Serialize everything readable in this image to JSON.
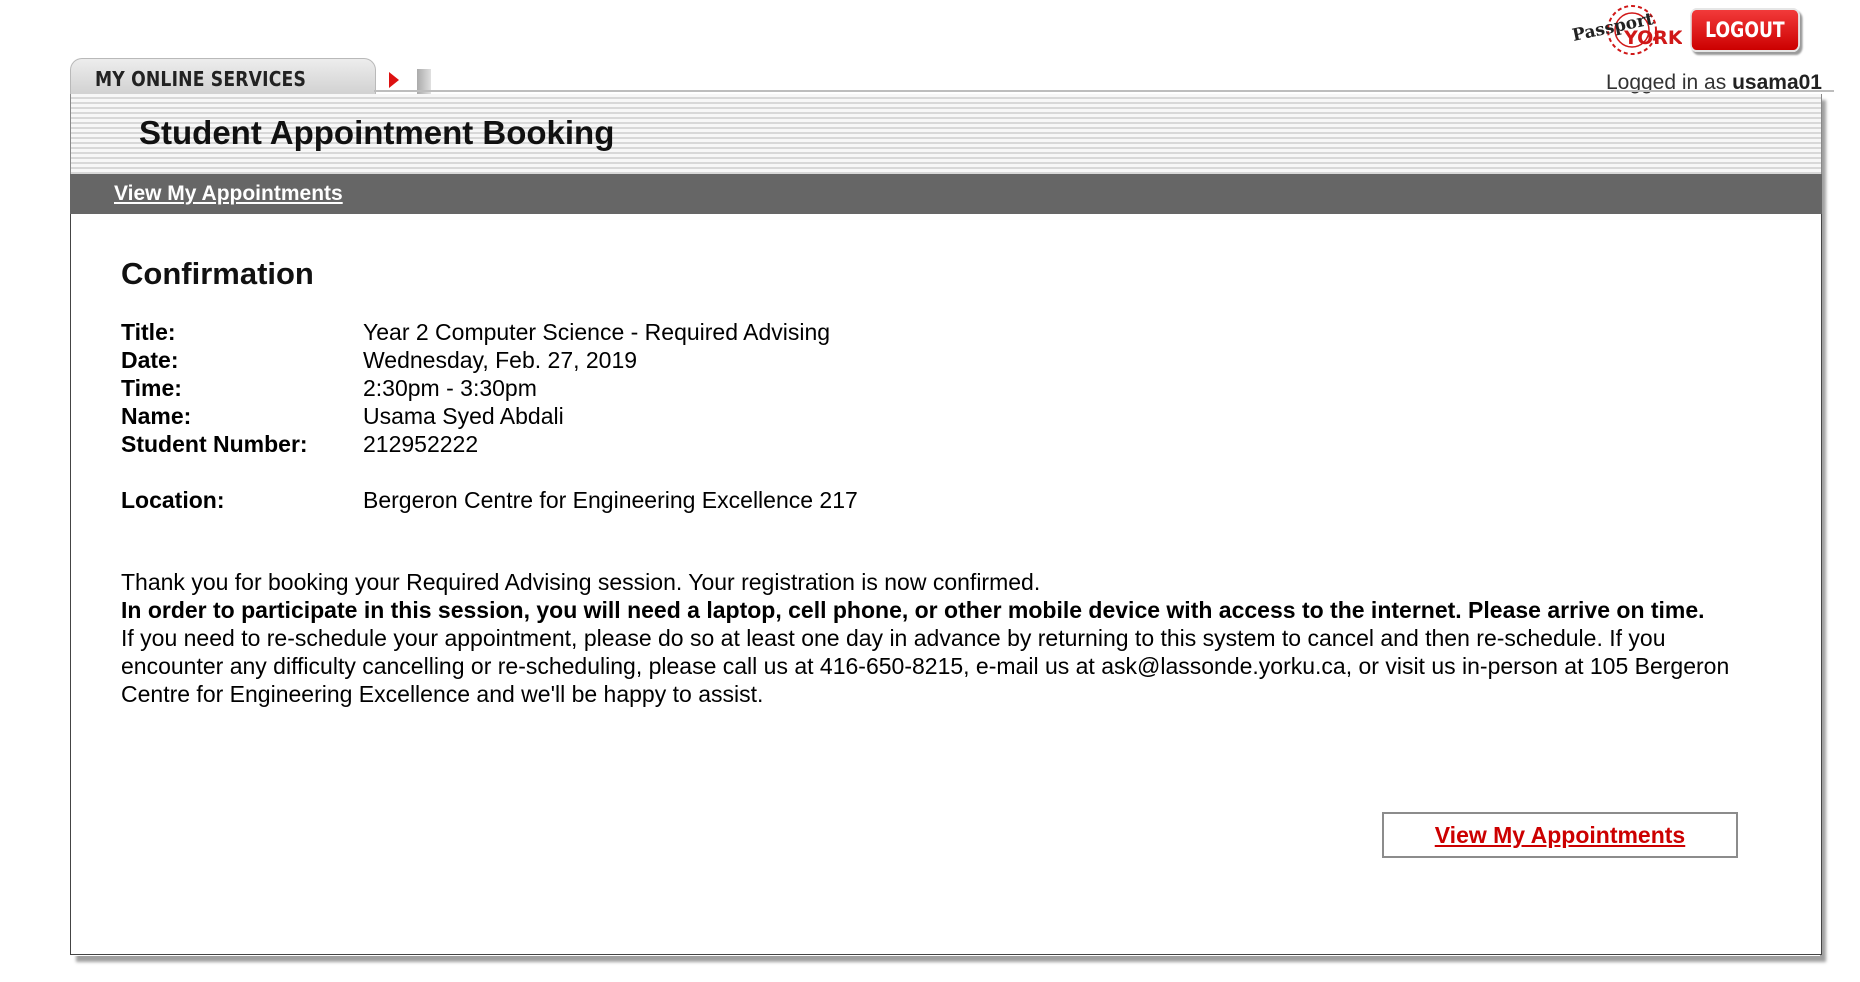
{
  "header": {
    "logout_label": "LOGOUT",
    "logged_in_prefix": "Logged in as",
    "username": "usama01",
    "brand_logo_text": "Passport YORK"
  },
  "tab": {
    "label": "MY ONLINE SERVICES"
  },
  "page": {
    "title": "Student Appointment Booking",
    "nav_link": "View My Appointments"
  },
  "confirmation": {
    "heading": "Confirmation",
    "fields": [
      {
        "label": "Title:",
        "value": "Year 2 Computer Science - Required Advising"
      },
      {
        "label": "Date:",
        "value": "Wednesday, Feb. 27, 2019"
      },
      {
        "label": "Time:",
        "value": "2:30pm - 3:30pm"
      },
      {
        "label": "Name:",
        "value": "Usama Syed Abdali"
      },
      {
        "label": "Student Number:",
        "value": "212952222"
      },
      {
        "label": "Location:",
        "value": "Bergeron Centre for Engineering Excellence 217"
      }
    ],
    "message_intro": "Thank you for booking your Required Advising session. Your registration is now confirmed.",
    "message_bold": "In order to participate in this session, you will need a laptop, cell phone, or other mobile device with access to the internet. Please arrive on time.",
    "message_reschedule": "If you need to re-schedule your appointment, please do so at least one day in advance by returning to this system to cancel and then re-schedule. If you encounter any difficulty cancelling or re-scheduling, please call us at 416-650-8215, e-mail us at ask@lassonde.yorku.ca, or visit us in-person at 105 Bergeron Centre for Engineering Excellence and we'll be happy to assist.",
    "button_label": "View My Appointments"
  },
  "colors": {
    "accent_red": "#cc0000",
    "nav_bar": "#666666"
  }
}
